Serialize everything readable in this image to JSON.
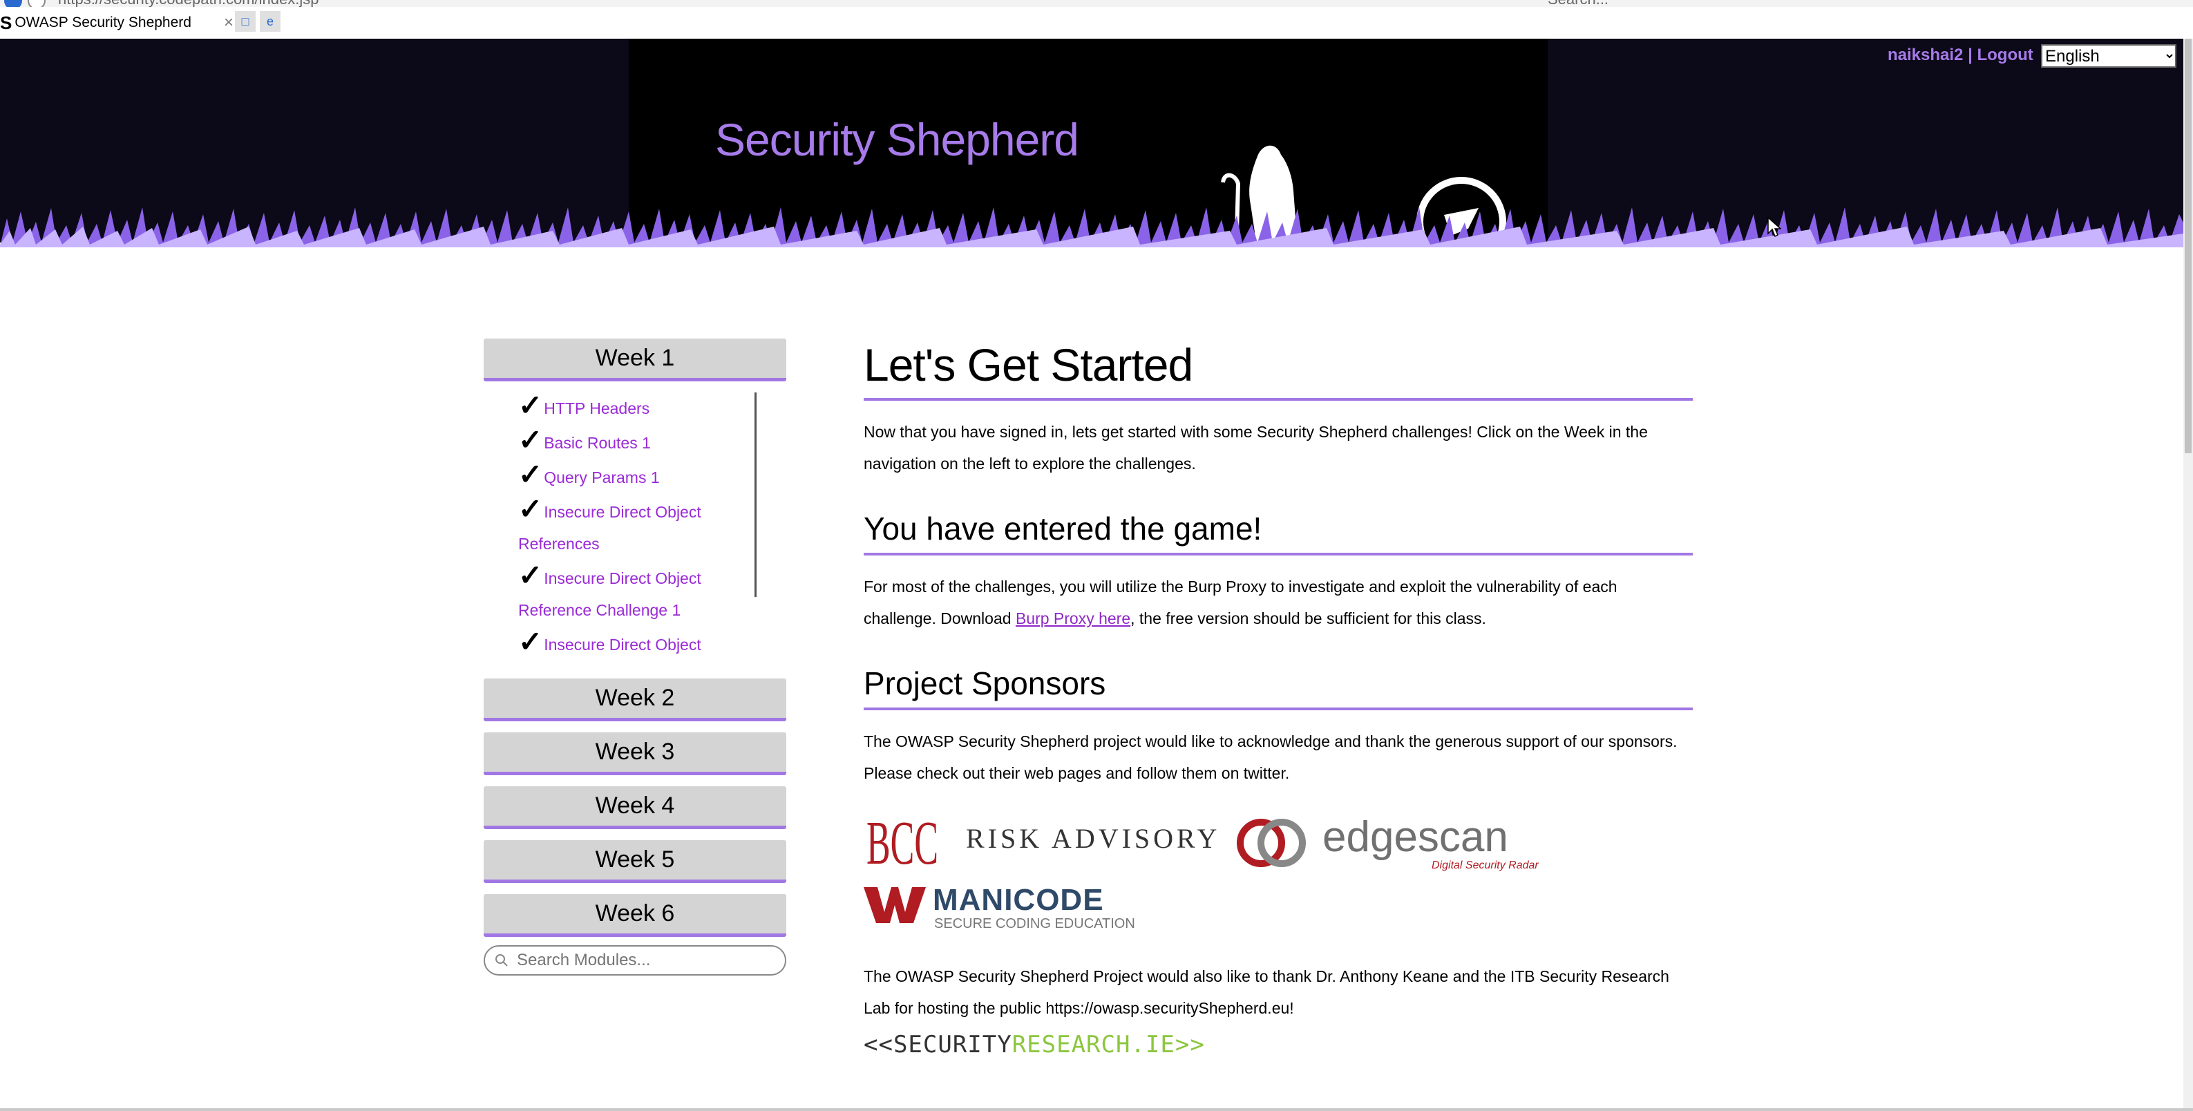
{
  "browser": {
    "url": "https://security.codepath.com/index.jsp",
    "search_placeholder": "Search...",
    "tab_title": "OWASP Security Shepherd",
    "tab_favicon": "S",
    "tab_close": "×"
  },
  "header": {
    "title": "Security Shepherd",
    "username": "naikshai2",
    "separator": " | ",
    "logout_label": "Logout",
    "language_selected": "English",
    "accent_color": "#a77bea"
  },
  "sidebar": {
    "weeks": [
      "Week 1",
      "Week 2",
      "Week 3",
      "Week 4",
      "Week 5",
      "Week 6"
    ],
    "week1_modules": [
      {
        "label": "HTTP Headers",
        "completed": true
      },
      {
        "label": "Basic Routes 1",
        "completed": true
      },
      {
        "label": "Query Params 1",
        "completed": true
      },
      {
        "label": "Insecure Direct Object References",
        "completed": true
      },
      {
        "label": "Insecure Direct Object Reference Challenge 1",
        "completed": true
      },
      {
        "label": "Insecure Direct Object",
        "completed": true
      }
    ],
    "check_glyph": "✓",
    "search_placeholder": "Search Modules..."
  },
  "main": {
    "heading": "Let's Get Started",
    "intro": "Now that you have signed in, lets get started with some Security Shepherd challenges! Click on the Week in the navigation on the left to explore the challenges.",
    "section2_heading": "You have entered the game!",
    "section2_text_before": "For most of the challenges, you will utilize the Burp Proxy to investigate and exploit the vulnerability of each challenge. Download ",
    "burp_link": "Burp Proxy here",
    "section2_text_after": ", the free version should be sufficient for this class.",
    "section3_heading": "Project Sponsors",
    "sponsors_text": "The OWASP Security Shepherd project would like to acknowledge and thank the generous support of our sponsors. Please check out their web pages and follow them on twitter.",
    "sponsors": {
      "bcc_mark": "BCC",
      "risk_advisory": "RISK ADVISORY",
      "edgescan": "edgescan",
      "edgescan_tag": "Digital Security Radar",
      "manicode": "MANICODE",
      "manicode_tag": "SECURE CODING EDUCATION"
    },
    "thanks_text": "The OWASP Security Shepherd Project would also like to thank Dr. Anthony Keane and the ITB Security Research Lab for hosting the public https://owasp.securityShepherd.eu!",
    "security_research_a": "<<SECURITY",
    "security_research_b": "RESEARCH.IE>>"
  }
}
